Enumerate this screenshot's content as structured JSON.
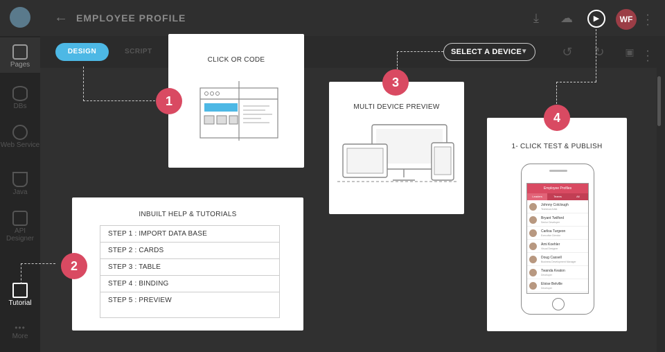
{
  "header": {
    "title": "EMPLOYEE PROFILE",
    "avatar_initials": "WF"
  },
  "sidebar": {
    "items": [
      {
        "label": "Pages",
        "icon": "pages-icon"
      },
      {
        "label": "DBs",
        "icon": "database-icon"
      },
      {
        "label": "Web Service",
        "icon": "globe-icon"
      },
      {
        "label": "Java",
        "icon": "coffee-icon"
      },
      {
        "label": "API Designer",
        "icon": "api-icon"
      },
      {
        "label": "Tutorial",
        "icon": "book-icon"
      },
      {
        "label": "More",
        "icon": "more-dots-icon"
      }
    ]
  },
  "toolbar": {
    "design_tab": "DESIGN",
    "script_tab": "SCRIPT",
    "device_select": "SELECT A DEVICE"
  },
  "callouts": {
    "c1": {
      "number": "1",
      "title": "CLICK OR CODE"
    },
    "c2": {
      "number": "2",
      "title": "INBUILT HELP & TUTORIALS",
      "steps": [
        "STEP 1 : IMPORT DATA BASE",
        "STEP 2 : CARDS",
        "STEP 3 : TABLE",
        "STEP 4 : BINDING",
        "STEP 5 : PREVIEW"
      ]
    },
    "c3": {
      "number": "3",
      "title": "MULTI DEVICE PREVIEW"
    },
    "c4": {
      "number": "4",
      "title": "1- CLICK TEST & PUBLISH"
    }
  },
  "phone_app": {
    "title": "Employee Profiles",
    "tabs": [
      "Leaders",
      "Teams",
      "All"
    ],
    "employees": [
      {
        "name": "Johnny Colclough",
        "role": "Technical Artist"
      },
      {
        "name": "Bryant Twilford",
        "role": "Senior Developer"
      },
      {
        "name": "Carlisa Turgeon",
        "role": "Executive Director"
      },
      {
        "name": "Ami Koehler",
        "role": "Visual Designer"
      },
      {
        "name": "Doug Cassell",
        "role": "Business Development Manager"
      },
      {
        "name": "Twanda Keaton",
        "role": "Developer"
      },
      {
        "name": "Eloise Belville",
        "role": "Developer"
      }
    ]
  },
  "colors": {
    "accent": "#d94a62",
    "design_tab": "#4db8e5"
  }
}
